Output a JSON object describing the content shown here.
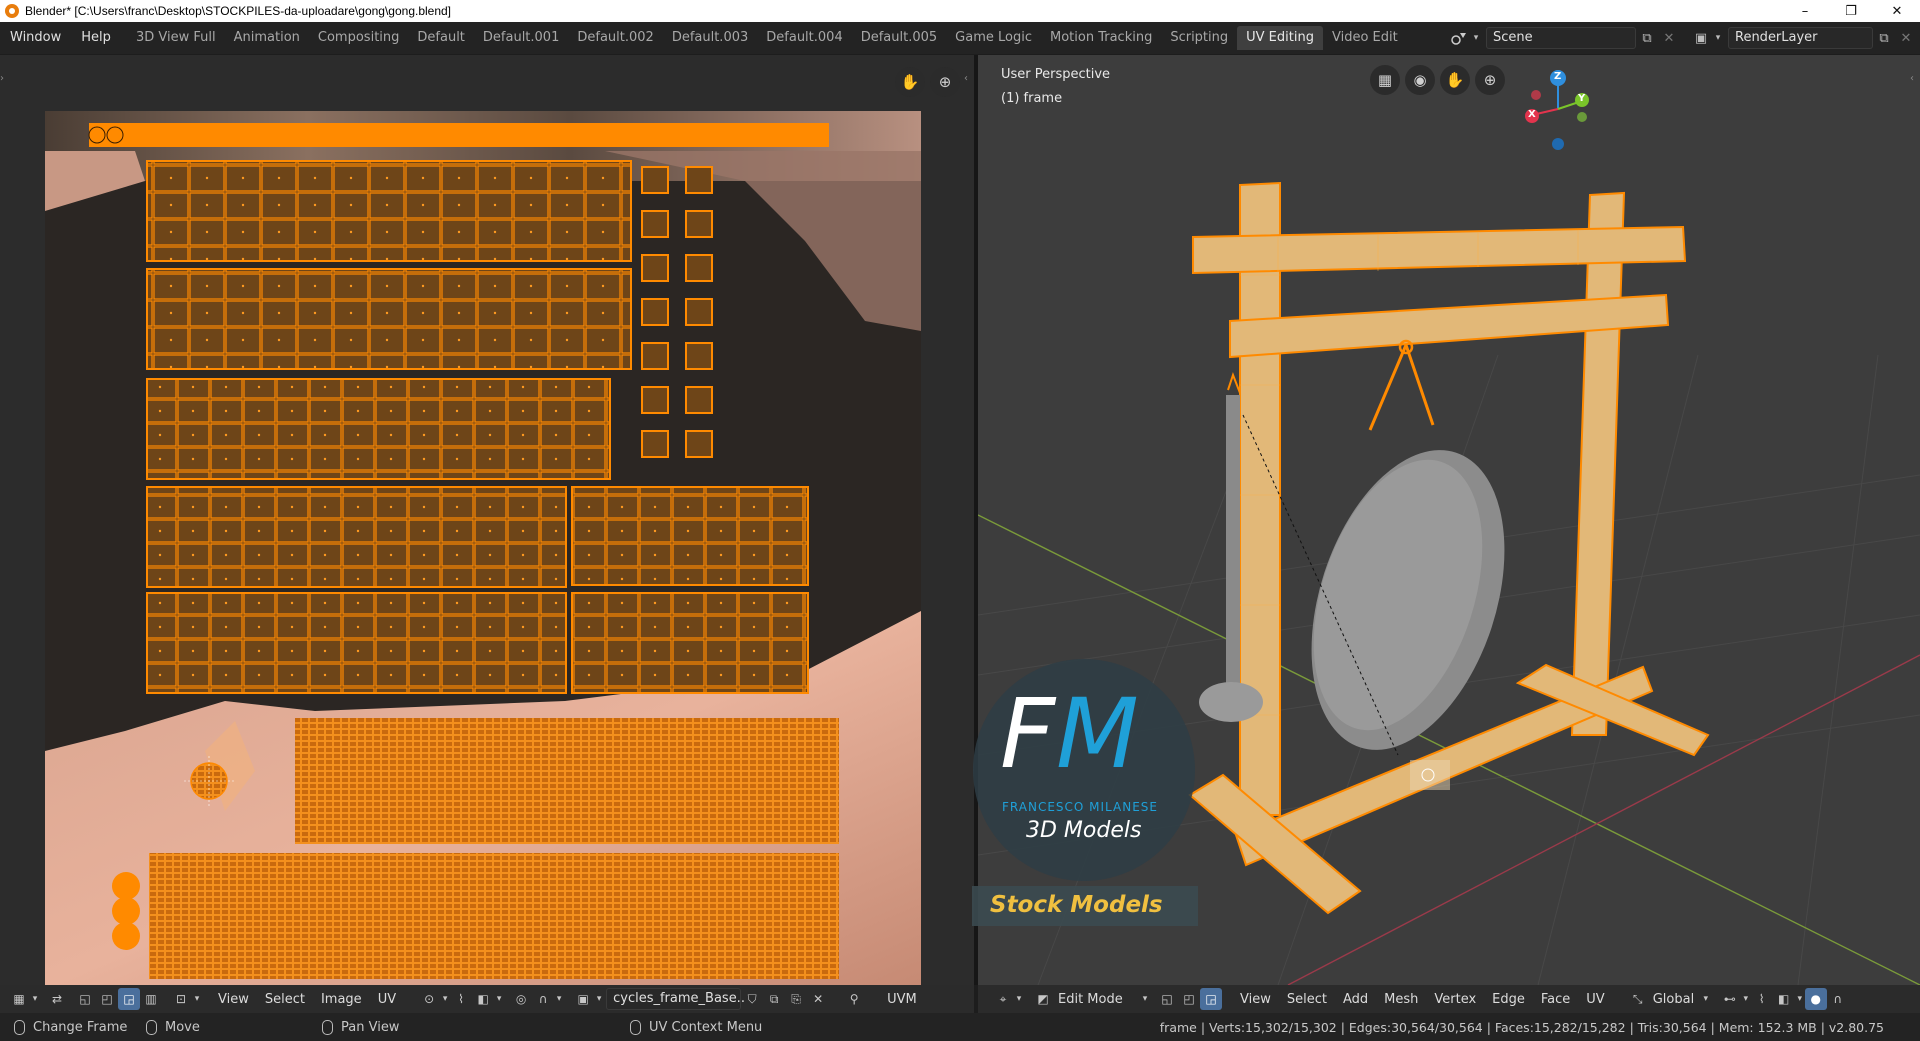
{
  "window": {
    "title": "Blender* [C:\\Users\\franc\\Desktop\\STOCKPILES-da-uploadare\\gong\\gong.blend]",
    "controls": [
      "–",
      "❐",
      "✕"
    ]
  },
  "menu": {
    "items": [
      "Window",
      "Help"
    ]
  },
  "workspaces": {
    "tabs": [
      "3D View Full",
      "Animation",
      "Compositing",
      "Default",
      "Default.001",
      "Default.002",
      "Default.003",
      "Default.004",
      "Default.005",
      "Game Logic",
      "Motion Tracking",
      "Scripting",
      "UV Editing",
      "Video Edit"
    ],
    "active": "UV Editing"
  },
  "scene": {
    "name": "Scene",
    "render_layer": "RenderLayer"
  },
  "uv_editor": {
    "header_menus": [
      "View",
      "Select",
      "Image",
      "UV"
    ],
    "image_name": "cycles_frame_Base..",
    "uvm_label": "UVM",
    "icons": [
      "hand-icon",
      "zoom-icon"
    ]
  },
  "viewport": {
    "view_name": "User Perspective",
    "object_label": "(1) frame",
    "mode": "Edit Mode",
    "header_menus": [
      "View",
      "Select",
      "Add",
      "Mesh",
      "Vertex",
      "Edge",
      "Face",
      "UV"
    ],
    "transform_orientation": "Global",
    "gizmo": {
      "x": "X",
      "y": "Y",
      "z": "Z"
    }
  },
  "logo": {
    "initials_f": "F",
    "initials_m": "M",
    "name": "FRANCESCO MILANESE",
    "line2": "3D Models",
    "banner": "Stock Models"
  },
  "status": {
    "hints": [
      {
        "icon": "mouse-left-icon",
        "label": "Change Frame"
      },
      {
        "icon": "mouse-right-icon",
        "label": "Move"
      },
      {
        "icon": "mouse-middle-icon",
        "label": "Pan View"
      },
      {
        "icon": "mouse-right-icon",
        "label": "UV Context Menu"
      }
    ],
    "stats": "frame | Verts:15,302/15,302 | Edges:30,564/30,564 | Faces:15,282/15,282 | Tris:30,564 | Mem: 152.3 MB | v2.80.75"
  },
  "colors": {
    "selection_orange": "#ff8a00",
    "uv_face_fill": "#7a4a1a",
    "frame_wood": "#e2b878",
    "gong_gray": "#8a8a8a",
    "active_tab": "#3f3f3f",
    "axis_x": "#e3344d",
    "axis_y": "#7ac52a",
    "axis_z": "#2f8fde"
  }
}
